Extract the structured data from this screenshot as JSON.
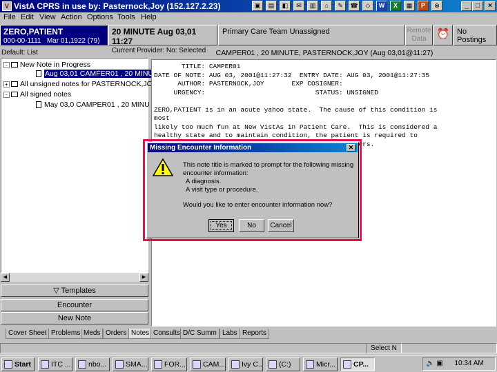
{
  "titlebar": {
    "title": "VistA CPRS in use by: Pasternock,Joy  (152.127.2.23)",
    "app_icon": "V",
    "toolbar_icons": [
      "app-icon-1",
      "app-icon-2",
      "app-icon-3",
      "mail-icon",
      "app-icon-5",
      "app-icon-6",
      "app-icon-7",
      "app-icon-8",
      "app-icon-9",
      "word-icon",
      "excel-icon",
      "app-icon-12",
      "powerpoint-icon",
      "app-icon-14"
    ],
    "toolbar_glyphs": [
      "▣",
      "▤",
      "◧",
      "✉",
      "▥",
      "⌂",
      "✎",
      "☎",
      "◇",
      "W",
      "X",
      "▦",
      "P",
      "⊗"
    ],
    "minimize": "_",
    "maximize": "□",
    "close": "×"
  },
  "menu": [
    "File",
    "Edit",
    "View",
    "Action",
    "Options",
    "Tools",
    "Help"
  ],
  "header": {
    "patient_name": "ZERO,PATIENT",
    "patient_id": "000-00-1111",
    "patient_dob": "Mar 01,1922 (79)",
    "visit": "20 MINUTE Aug 03,01 11:27",
    "provider": "Current Provider: No: Selected",
    "team": "Primary Care Team Unassigned",
    "remote_line1": "Remote",
    "remote_line2": "Data",
    "postings": "No Postings"
  },
  "left_pane": {
    "list_label": "Default: List",
    "tree": [
      {
        "label": "New Note in Progress",
        "level": 0,
        "expander": "-"
      },
      {
        "label": "Aug 03,01  CAMFER01 , 20 MINU",
        "level": 1,
        "expander": ""
      },
      {
        "label": "All unsigned notes for PASTERNOCK,JOY",
        "level": 0,
        "expander": "+"
      },
      {
        "label": "All signed notes",
        "level": 0,
        "expander": "-"
      },
      {
        "label": "May 03,0    CAMPER01 , 20 MINU",
        "level": 1,
        "expander": ""
      }
    ],
    "templates_btn": "▽ Templates",
    "encounter_btn": "Encounter",
    "new_note_btn": "New Note"
  },
  "note": {
    "header": "CAMPER01 , 20 MINUTE, PASTERNOCK,JOY  (Aug 03,01@11:27)",
    "body": "       TITLE: CAMPER01\nDATE OF NOTE: AUG 03, 2001@11:27:32  ENTRY DATE: AUG 03, 2001@11:27:35\n      AUTHOR: PASTERNOCK,JOY       EXP COSIGNER:\n     URGENCY:                            STATUS: UNSIGNED\n\nZERO,PATIENT is in an acute yahoo state.  The cause of this condition is\nmost\nlikely too much fun at New VistAs in Patient Care.  This is considered a\nhealthy state and to maintain condition, the patient is required to\n                                                    ers."
  },
  "tabs": [
    "Cover Sheet",
    "Problems",
    "Meds",
    "Orders",
    "Notes",
    "Consults",
    "D/C Summ",
    "Labs",
    "Reports"
  ],
  "active_tab": "Notes",
  "status": {
    "select": "Select N"
  },
  "taskbar": {
    "start": "Start",
    "buttons": [
      "ITC ...",
      "nbo...",
      "SMA...",
      "FOR...",
      "CAM...",
      "Ivy C...",
      "(C:)",
      "Micr...",
      "CP..."
    ],
    "time": "10:34 AM"
  },
  "dialog": {
    "title": "Missing Encounter Information",
    "line1": "This note title is marked to prompt for the following missing",
    "line2": "encounter information:",
    "line3": "A diagnosis.",
    "line4": "A visit type or procedure.",
    "question": "Would you like to enter encounter information now?",
    "yes": "Yes",
    "no": "No",
    "cancel": "Cancel"
  },
  "colors": {
    "highlight": "#e8104a",
    "title_bar": "#000080",
    "selection": "#000080"
  }
}
